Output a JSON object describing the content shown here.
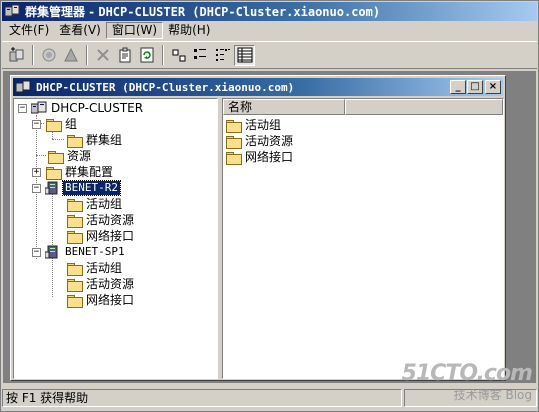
{
  "window": {
    "title_prefix": "群集管理器 - ",
    "title_mono": "DHCP-CLUSTER (DHCP-Cluster.xiaonuo.com)"
  },
  "menu": [
    {
      "label": "文件(F)"
    },
    {
      "label": "查看(V)"
    },
    {
      "label": "窗口(W)"
    },
    {
      "label": "帮助(H)"
    }
  ],
  "toolbar": {
    "icons": [
      "new-group-icon",
      "bring-online-icon",
      "take-offline-icon",
      "delete-icon",
      "properties-icon",
      "refresh-icon",
      "large-icons-view-icon",
      "small-icons-view-icon",
      "list-view-icon",
      "details-view-icon"
    ]
  },
  "child_window": {
    "title": "DHCP-CLUSTER (DHCP-Cluster.xiaonuo.com)",
    "buttons": {
      "minimize": "_",
      "maximize": "□",
      "close": "×"
    }
  },
  "tree": {
    "root": "DHCP-CLUSTER",
    "groups": "组",
    "cluster_group": "群集组",
    "resources": "资源",
    "cluster_config": "群集配置",
    "node1": "BENET-R2",
    "node1_active_groups": "活动组",
    "node1_active_resources": "活动资源",
    "node1_network_interfaces": "网络接口",
    "node2": "BENET-SP1",
    "node2_active_groups": "活动组",
    "node2_active_resources": "活动资源",
    "node2_network_interfaces": "网络接口"
  },
  "list": {
    "column_name": "名称",
    "items": [
      "活动组",
      "活动资源",
      "网络接口"
    ]
  },
  "status": {
    "text": "按 F1 获得帮助"
  },
  "watermark": {
    "line1": "51CTO.com",
    "line2": "技术博客  Blog"
  }
}
